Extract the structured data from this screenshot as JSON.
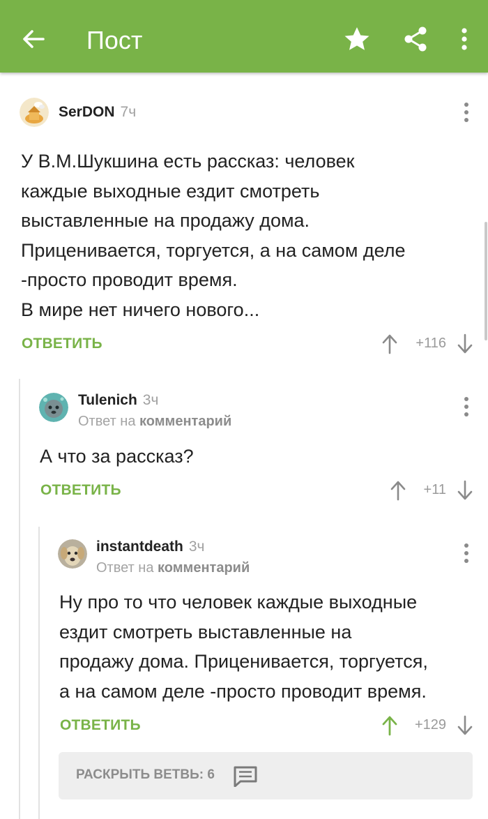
{
  "appbar": {
    "title": "Пост",
    "back_icon": "arrow-left-icon",
    "star_icon": "star-icon",
    "share_icon": "share-icon",
    "more_icon": "more-vertical-icon",
    "background": "#79b348"
  },
  "comments": [
    {
      "author": "SerDON",
      "time": "7ч",
      "text_lines": [
        "У В.М.Шукшина есть рассказ: человек",
        "каждые выходные ездит смотреть",
        "выставленные на продажу дома.",
        "Прицениваетcя, торгуется, а на самом деле",
        "-просто проводит время.",
        "В мире нет ничего нового..."
      ],
      "reply_label": "ОТВЕТИТЬ",
      "score": "+116"
    },
    {
      "author": "Tulenich",
      "time": "3ч",
      "reply_to_prefix": "Ответ на",
      "reply_to_target": "комментарий",
      "text_lines": [
        "А что за рассказ?"
      ],
      "reply_label": "ОТВЕТИТЬ",
      "score": "+11"
    },
    {
      "author": "instantdeath",
      "time": "3ч",
      "reply_to_prefix": "Ответ на",
      "reply_to_target": "комментарий",
      "text_lines": [
        "Ну про то что человек каждые выходные",
        "ездит смотреть выставленные на",
        "продажу дома. Прицениваетcя, торгуется,",
        "а на самом деле -просто проводит время."
      ],
      "reply_label": "ОТВЕТИТЬ",
      "score": "+129",
      "upvoted": true
    }
  ],
  "expand_branch": {
    "label": "РАСКРЫТЬ ВЕТВЬ: 6",
    "icon": "comment-icon"
  },
  "colors": {
    "accent": "#79b348",
    "muted": "#9a9a9a"
  }
}
